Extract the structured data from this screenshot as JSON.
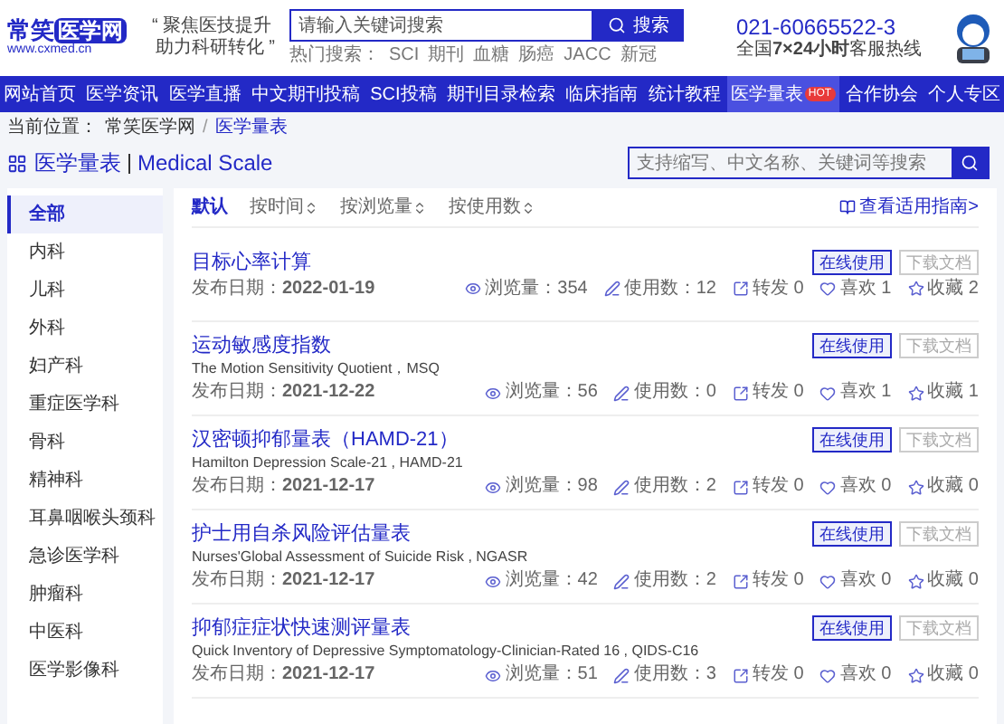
{
  "header": {
    "logo": {
      "text_1": "常笑",
      "text_2": "医学网",
      "url": "www.cxmed.cn"
    },
    "slogan": [
      "“ 聚焦医技提升",
      "助力科研转化 ”"
    ],
    "search": {
      "placeholder": "请输入关键词搜索",
      "button": "搜索"
    },
    "hot_search": {
      "label": "热门搜索：",
      "terms": [
        "SCI",
        "期刊",
        "血糖",
        "肠癌",
        "JACC",
        "新冠"
      ]
    },
    "phone": "021-60665522-3",
    "hotline": "全国**7×24小时**客服热线"
  },
  "nav": [
    {
      "label": "网站首页",
      "selected": false
    },
    {
      "label": "医学资讯",
      "selected": false
    },
    {
      "label": "医学直播",
      "selected": false
    },
    {
      "label": "中文期刊投稿",
      "selected": false
    },
    {
      "label": "SCI投稿",
      "selected": false
    },
    {
      "label": "期刊目录检索",
      "selected": false
    },
    {
      "label": "临床指南",
      "selected": false
    },
    {
      "label": "统计教程",
      "selected": false
    },
    {
      "label": "医学量表",
      "selected": true,
      "badge": "HOT"
    },
    {
      "label": "合作协会",
      "selected": false
    },
    {
      "label": "个人专区",
      "selected": false
    }
  ],
  "breadcrumb": {
    "label": "当前位置：",
    "items": [
      "常笑医学网",
      "医学量表"
    ],
    "separator": "/"
  },
  "page_title": {
    "text": "医学量表",
    "english": "Medical Scale",
    "search_placeholder": "支持缩写、中文名称、关键词等搜索"
  },
  "sidebar": {
    "items": [
      {
        "label": "全部",
        "selected": true
      },
      {
        "label": "内科",
        "selected": false
      },
      {
        "label": "儿科",
        "selected": false
      },
      {
        "label": "外科",
        "selected": false
      },
      {
        "label": "妇产科",
        "selected": false
      },
      {
        "label": "重症医学科",
        "selected": false
      },
      {
        "label": "骨科",
        "selected": false
      },
      {
        "label": "精神科",
        "selected": false
      },
      {
        "label": "耳鼻咽喉头颈科",
        "selected": false
      },
      {
        "label": "急诊医学科",
        "selected": false
      },
      {
        "label": "肿瘤科",
        "selected": false
      },
      {
        "label": "中医科",
        "selected": false
      },
      {
        "label": "医学影像科",
        "selected": false
      }
    ]
  },
  "sort_tabs": [
    {
      "label": "默认",
      "kind": "plain",
      "selected": true
    },
    {
      "label": "按时间",
      "kind": "sort",
      "selected": false
    },
    {
      "label": "按浏览量",
      "kind": "sort",
      "selected": false
    },
    {
      "label": "按使用数",
      "kind": "sort",
      "selected": false
    }
  ],
  "guide_link": "查看适用指南>",
  "scales": [
    {
      "title": "目标心率计算",
      "date": "发布日期：**2022-01-19**",
      "buttons": [
        {
          "label": "在线使用",
          "disabled": false
        },
        {
          "label": "下载文档",
          "disabled": true
        }
      ],
      "stats": [
        {
          "kind": "views",
          "text": "浏览量：354"
        },
        {
          "kind": "uses",
          "text": "使用数：12"
        },
        {
          "kind": "shares",
          "text": "转发 0"
        },
        {
          "kind": "likes",
          "text": "喜欢 1"
        },
        {
          "kind": "favorites",
          "text": "收藏 2"
        }
      ]
    },
    {
      "title": "运动敏感度指数",
      "subtitle": "The Motion Sensitivity Quotient，MSQ",
      "date": "发布日期：**2021-12-22**",
      "buttons": [
        {
          "label": "在线使用",
          "disabled": false
        },
        {
          "label": "下载文档",
          "disabled": true
        }
      ],
      "stats": [
        {
          "kind": "views",
          "text": "浏览量：56"
        },
        {
          "kind": "uses",
          "text": "使用数：0"
        },
        {
          "kind": "shares",
          "text": "转发 0"
        },
        {
          "kind": "likes",
          "text": "喜欢 1"
        },
        {
          "kind": "favorites",
          "text": "收藏 1"
        }
      ]
    },
    {
      "title": "汉密顿抑郁量表（HAMD-21）",
      "subtitle": "Hamilton Depression Scale-21 , HAMD-21",
      "date": "发布日期：**2021-12-17**",
      "buttons": [
        {
          "label": "在线使用",
          "disabled": false
        },
        {
          "label": "下载文档",
          "disabled": true
        }
      ],
      "stats": [
        {
          "kind": "views",
          "text": "浏览量：98"
        },
        {
          "kind": "uses",
          "text": "使用数：2"
        },
        {
          "kind": "shares",
          "text": "转发 0"
        },
        {
          "kind": "likes",
          "text": "喜欢 0"
        },
        {
          "kind": "favorites",
          "text": "收藏 0"
        }
      ]
    },
    {
      "title": "护士用自杀风险评估量表",
      "subtitle": "Nurses'Global Assessment of Suicide Risk , NGASR",
      "date": "发布日期：**2021-12-17**",
      "buttons": [
        {
          "label": "在线使用",
          "disabled": false
        },
        {
          "label": "下载文档",
          "disabled": true
        }
      ],
      "stats": [
        {
          "kind": "views",
          "text": "浏览量：42"
        },
        {
          "kind": "uses",
          "text": "使用数：2"
        },
        {
          "kind": "shares",
          "text": "转发 0"
        },
        {
          "kind": "likes",
          "text": "喜欢 0"
        },
        {
          "kind": "favorites",
          "text": "收藏 0"
        }
      ]
    },
    {
      "title": "抑郁症症状快速测评量表",
      "subtitle": "Quick Inventory of Depressive Symptomatology-Clinician-Rated 16 , QIDS-C16",
      "date": "发布日期：**2021-12-17**",
      "buttons": [
        {
          "label": "在线使用",
          "disabled": false
        },
        {
          "label": "下载文档",
          "disabled": true
        }
      ],
      "stats": [
        {
          "kind": "views",
          "text": "浏览量：51"
        },
        {
          "kind": "uses",
          "text": "使用数：3"
        },
        {
          "kind": "shares",
          "text": "转发 0"
        },
        {
          "kind": "likes",
          "text": "喜欢 0"
        },
        {
          "kind": "favorites",
          "text": "收藏 0"
        }
      ]
    }
  ]
}
